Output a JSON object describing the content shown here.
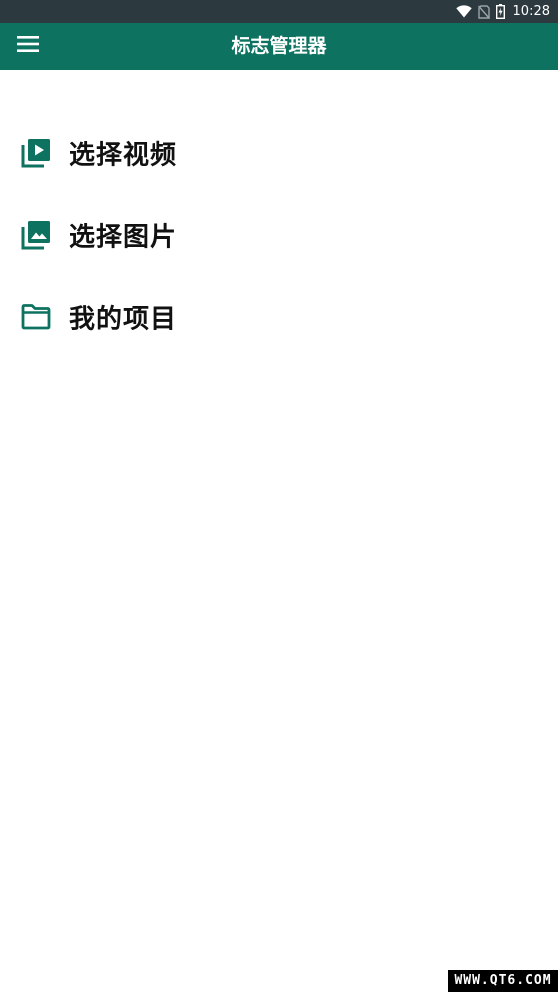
{
  "status_bar": {
    "time": "10:28",
    "icons": [
      "wifi-icon",
      "no-sim-icon",
      "battery-charging-icon"
    ]
  },
  "app_bar": {
    "title": "标志管理器",
    "menu_icon": "hamburger-menu-icon",
    "background_color": "#0e7261"
  },
  "menu": {
    "items": [
      {
        "label": "选择视频",
        "icon": "video-library-icon"
      },
      {
        "label": "选择图片",
        "icon": "photo-library-icon"
      },
      {
        "label": "我的项目",
        "icon": "folder-icon"
      }
    ],
    "icon_color": "#0e7261"
  },
  "watermark": {
    "text": "WWW.QT6.COM"
  }
}
